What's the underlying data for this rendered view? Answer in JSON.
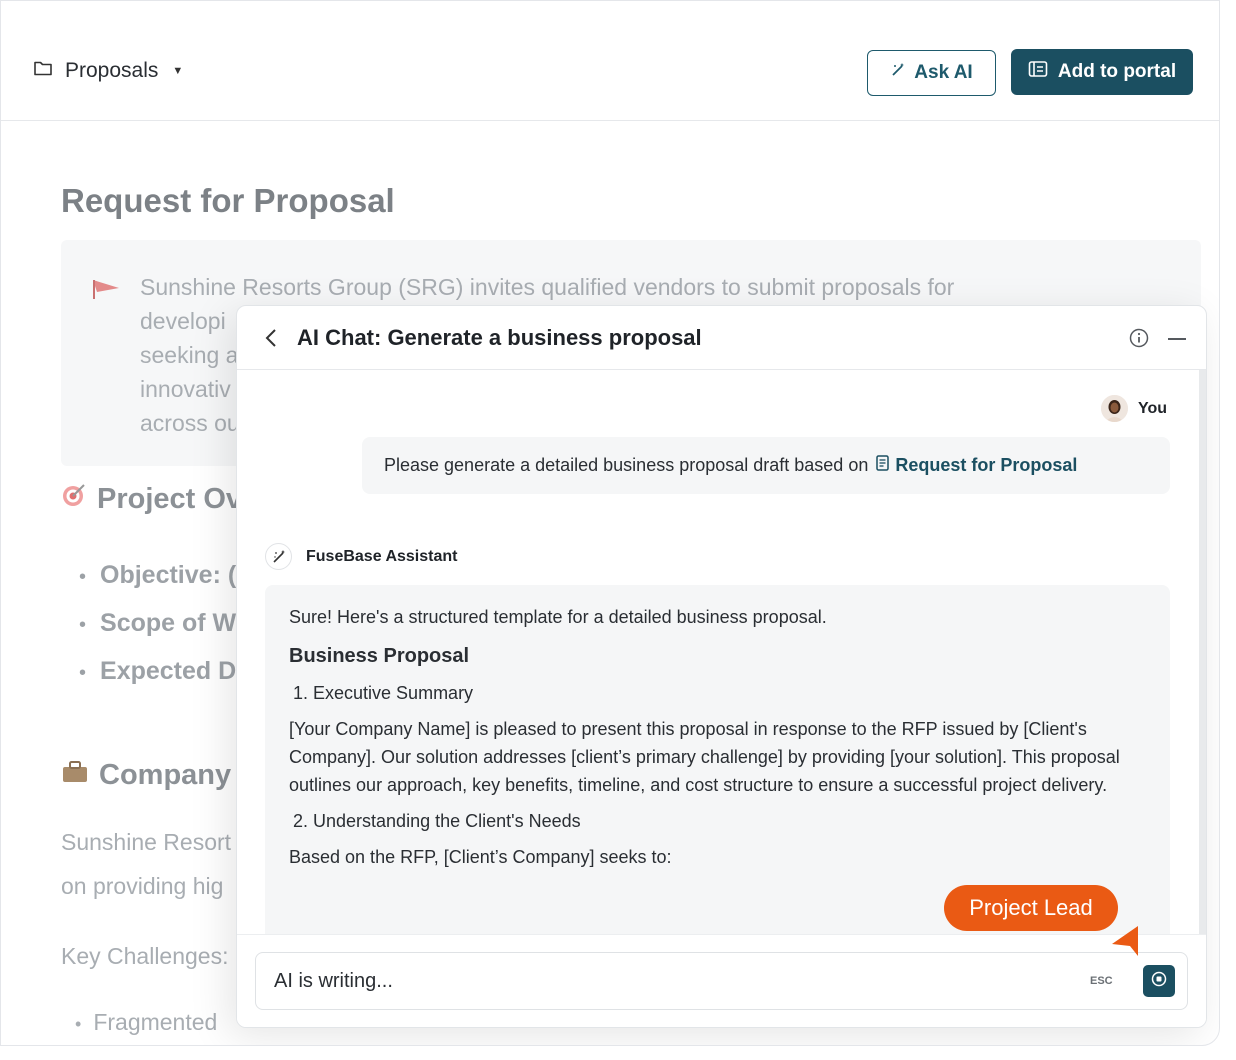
{
  "toolbar": {
    "breadcrumb": "Proposals",
    "ask_ai_label": "Ask AI",
    "add_to_portal_label": "Add to portal"
  },
  "document": {
    "title": "Request for Proposal",
    "callout_text": "Sunshine Resorts Group (SRG) invites qualified vendors to submit proposals for developi",
    "callout_lines": [
      "Sunshine Resorts Group (SRG) invites qualified vendors to submit proposals for",
      "developi",
      "seeking a",
      "innovativ",
      "across ou"
    ],
    "section_overview": "Project Ov",
    "bullets": [
      "Objective: (",
      "Scope of W",
      "Expected D"
    ],
    "section_company": "Company",
    "company_line1": "Sunshine Resort",
    "company_line2": "on providing hig",
    "key_challenges": "Key Challenges:",
    "bottom_bullet": "Fragmented"
  },
  "chat": {
    "title": "AI Chat: Generate a business proposal",
    "user_name": "You",
    "user_message": "Please generate a detailed business proposal draft based on",
    "user_ref": "Request for Proposal",
    "assistant_name": "FuseBase Assistant",
    "answer_intro": "Sure! Here's a structured template for a detailed business proposal.",
    "answer_heading": "Business Proposal",
    "item1": "1. Executive Summary",
    "item1_text": "[Your Company Name] is pleased to present this proposal in response to the RFP issued by [Client's Company]. Our solution addresses [client’s primary challenge] by providing [your solution]. This proposal outlines our approach, key benefits, timeline, and cost structure to ensure a successful project delivery.",
    "item2": "2. Understanding the Client's Needs",
    "item2_text": "Based on the RFP, [Client’s Company] seeks to:",
    "input_text": "AI is writing...",
    "esc_label": "ESC"
  },
  "badge": {
    "label": "Project Lead",
    "color": "#ea5a14"
  },
  "colors": {
    "primary": "#1b4f61"
  },
  "icons": [
    "folder-icon",
    "chevron-down-icon",
    "magic-wand-icon",
    "portal-icon",
    "flag-icon",
    "target-icon",
    "briefcase-icon",
    "back-chevron-icon",
    "info-icon",
    "minimize-icon",
    "document-icon",
    "stop-icon",
    "cursor-pointer-icon"
  ]
}
